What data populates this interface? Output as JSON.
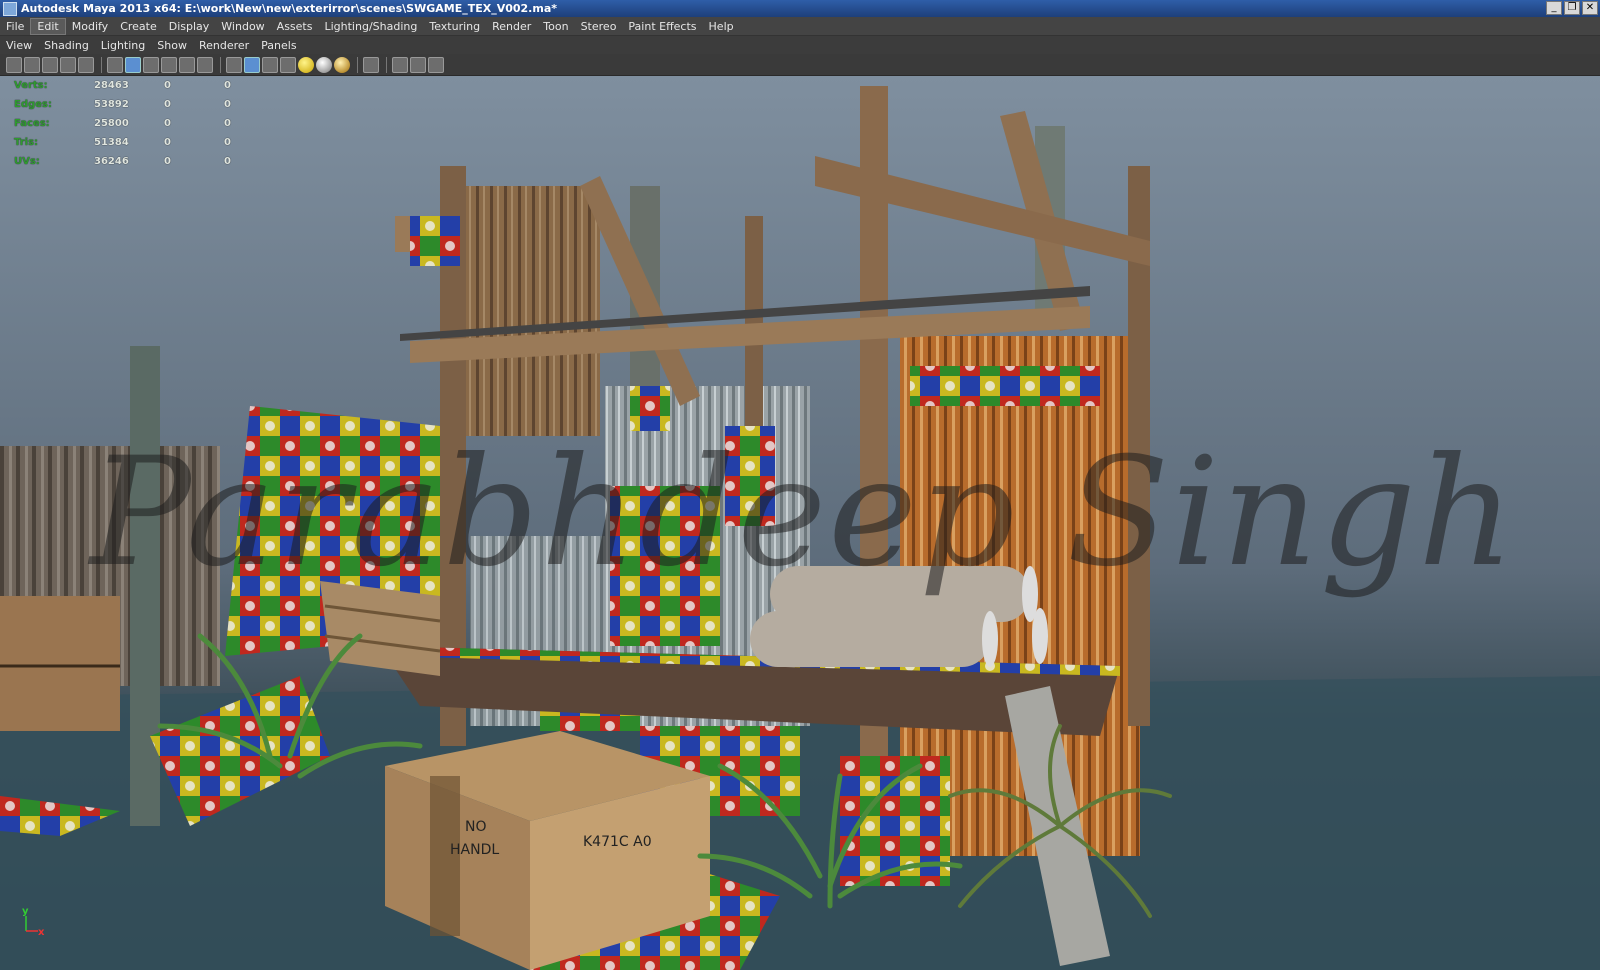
{
  "window": {
    "title": "Autodesk Maya 2013 x64: E:\\work\\New\\new\\exterirror\\scenes\\SWGAME_TEX_V002.ma*",
    "minimize_glyph": "_",
    "restore_glyph": "❐",
    "close_glyph": "✕"
  },
  "main_menu": [
    "File",
    "Edit",
    "Modify",
    "Create",
    "Display",
    "Window",
    "Assets",
    "Lighting/Shading",
    "Texturing",
    "Render",
    "Toon",
    "Stereo",
    "Paint Effects",
    "Help"
  ],
  "active_menu": "Edit",
  "panel_menu": [
    "View",
    "Shading",
    "Lighting",
    "Show",
    "Renderer",
    "Panels"
  ],
  "toolbar_icons": [
    "camera-icon",
    "camera-attributes-icon",
    "bookmark-icon",
    "image-plane-icon",
    "grid-icon",
    "wireframe-icon",
    "smooth-shade-icon",
    "wireframe-on-shaded-icon",
    "textured-icon",
    "use-all-lights-icon",
    "shadows-icon",
    "xray-icon",
    "isolate-icon",
    "resolution-gate-icon",
    "field-chart-icon",
    "safe-action-icon"
  ],
  "hud": {
    "rows": [
      {
        "label": "Verts:",
        "value": "28463",
        "sel": "0",
        "comp": "0"
      },
      {
        "label": "Edges:",
        "value": "53892",
        "sel": "0",
        "comp": "0"
      },
      {
        "label": "Faces:",
        "value": "25800",
        "sel": "0",
        "comp": "0"
      },
      {
        "label": "Tris:",
        "value": "51384",
        "sel": "0",
        "comp": "0"
      },
      {
        "label": "UVs:",
        "value": "36246",
        "sel": "0",
        "comp": "0"
      }
    ]
  },
  "watermark": "Parabhdeep Singh",
  "scene": {
    "box_text_1": "NO",
    "box_text_2": "HANDL",
    "box_code": "K471C A0",
    "axis_x": "x",
    "axis_y": "y"
  },
  "colors": {
    "wood": "#8a6a48",
    "rust": "#b86c2c",
    "checker_red": "#c0281e",
    "checker_green": "#2d8a2a",
    "checker_blue": "#233fa8",
    "checker_yellow": "#c9b820"
  }
}
